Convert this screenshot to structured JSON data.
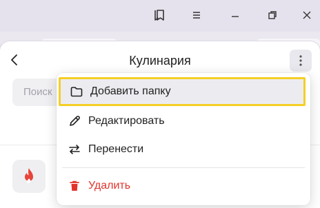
{
  "window": {
    "controls": [
      {
        "name": "bookmarks-icon"
      },
      {
        "name": "menu-icon"
      },
      {
        "name": "minimize-icon"
      },
      {
        "name": "restore-icon"
      },
      {
        "name": "close-icon"
      }
    ]
  },
  "panel": {
    "title": "Кулинария",
    "search_placeholder": "Поиск",
    "back_icon": "chevron-left-icon",
    "more_icon": "kebab-icon"
  },
  "menu": {
    "items": [
      {
        "label": "Добавить папку",
        "icon": "folder-icon",
        "highlighted": true
      },
      {
        "label": "Редактировать",
        "icon": "pencil-icon"
      },
      {
        "label": "Перенести",
        "icon": "move-arrows-icon"
      },
      {
        "label": "Удалить",
        "icon": "trash-icon",
        "danger": true
      }
    ]
  },
  "colors": {
    "titlebar": "#e6e2ed",
    "highlight_border": "#f5cf24",
    "danger": "#e2332b",
    "app_icon": "#e8443a"
  }
}
